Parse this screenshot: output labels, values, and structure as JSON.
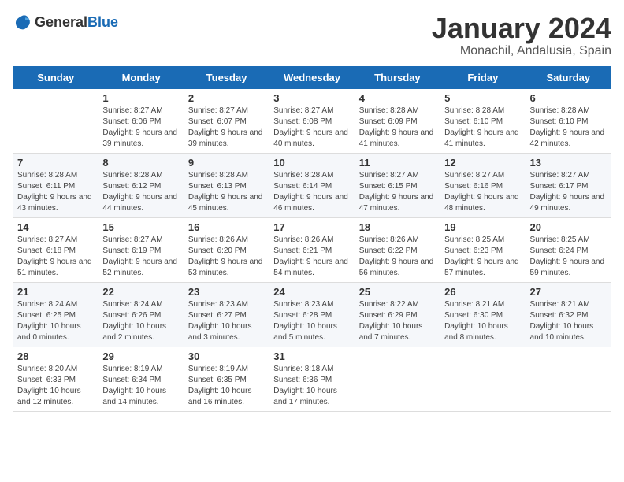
{
  "logo": {
    "text_general": "General",
    "text_blue": "Blue"
  },
  "header": {
    "month_year": "January 2024",
    "location": "Monachil, Andalusia, Spain"
  },
  "days_of_week": [
    "Sunday",
    "Monday",
    "Tuesday",
    "Wednesday",
    "Thursday",
    "Friday",
    "Saturday"
  ],
  "weeks": [
    [
      {
        "day": "",
        "sunrise": "",
        "sunset": "",
        "daylight": ""
      },
      {
        "day": "1",
        "sunrise": "Sunrise: 8:27 AM",
        "sunset": "Sunset: 6:06 PM",
        "daylight": "Daylight: 9 hours and 39 minutes."
      },
      {
        "day": "2",
        "sunrise": "Sunrise: 8:27 AM",
        "sunset": "Sunset: 6:07 PM",
        "daylight": "Daylight: 9 hours and 39 minutes."
      },
      {
        "day": "3",
        "sunrise": "Sunrise: 8:27 AM",
        "sunset": "Sunset: 6:08 PM",
        "daylight": "Daylight: 9 hours and 40 minutes."
      },
      {
        "day": "4",
        "sunrise": "Sunrise: 8:28 AM",
        "sunset": "Sunset: 6:09 PM",
        "daylight": "Daylight: 9 hours and 41 minutes."
      },
      {
        "day": "5",
        "sunrise": "Sunrise: 8:28 AM",
        "sunset": "Sunset: 6:10 PM",
        "daylight": "Daylight: 9 hours and 41 minutes."
      },
      {
        "day": "6",
        "sunrise": "Sunrise: 8:28 AM",
        "sunset": "Sunset: 6:10 PM",
        "daylight": "Daylight: 9 hours and 42 minutes."
      }
    ],
    [
      {
        "day": "7",
        "sunrise": "Sunrise: 8:28 AM",
        "sunset": "Sunset: 6:11 PM",
        "daylight": "Daylight: 9 hours and 43 minutes."
      },
      {
        "day": "8",
        "sunrise": "Sunrise: 8:28 AM",
        "sunset": "Sunset: 6:12 PM",
        "daylight": "Daylight: 9 hours and 44 minutes."
      },
      {
        "day": "9",
        "sunrise": "Sunrise: 8:28 AM",
        "sunset": "Sunset: 6:13 PM",
        "daylight": "Daylight: 9 hours and 45 minutes."
      },
      {
        "day": "10",
        "sunrise": "Sunrise: 8:28 AM",
        "sunset": "Sunset: 6:14 PM",
        "daylight": "Daylight: 9 hours and 46 minutes."
      },
      {
        "day": "11",
        "sunrise": "Sunrise: 8:27 AM",
        "sunset": "Sunset: 6:15 PM",
        "daylight": "Daylight: 9 hours and 47 minutes."
      },
      {
        "day": "12",
        "sunrise": "Sunrise: 8:27 AM",
        "sunset": "Sunset: 6:16 PM",
        "daylight": "Daylight: 9 hours and 48 minutes."
      },
      {
        "day": "13",
        "sunrise": "Sunrise: 8:27 AM",
        "sunset": "Sunset: 6:17 PM",
        "daylight": "Daylight: 9 hours and 49 minutes."
      }
    ],
    [
      {
        "day": "14",
        "sunrise": "Sunrise: 8:27 AM",
        "sunset": "Sunset: 6:18 PM",
        "daylight": "Daylight: 9 hours and 51 minutes."
      },
      {
        "day": "15",
        "sunrise": "Sunrise: 8:27 AM",
        "sunset": "Sunset: 6:19 PM",
        "daylight": "Daylight: 9 hours and 52 minutes."
      },
      {
        "day": "16",
        "sunrise": "Sunrise: 8:26 AM",
        "sunset": "Sunset: 6:20 PM",
        "daylight": "Daylight: 9 hours and 53 minutes."
      },
      {
        "day": "17",
        "sunrise": "Sunrise: 8:26 AM",
        "sunset": "Sunset: 6:21 PM",
        "daylight": "Daylight: 9 hours and 54 minutes."
      },
      {
        "day": "18",
        "sunrise": "Sunrise: 8:26 AM",
        "sunset": "Sunset: 6:22 PM",
        "daylight": "Daylight: 9 hours and 56 minutes."
      },
      {
        "day": "19",
        "sunrise": "Sunrise: 8:25 AM",
        "sunset": "Sunset: 6:23 PM",
        "daylight": "Daylight: 9 hours and 57 minutes."
      },
      {
        "day": "20",
        "sunrise": "Sunrise: 8:25 AM",
        "sunset": "Sunset: 6:24 PM",
        "daylight": "Daylight: 9 hours and 59 minutes."
      }
    ],
    [
      {
        "day": "21",
        "sunrise": "Sunrise: 8:24 AM",
        "sunset": "Sunset: 6:25 PM",
        "daylight": "Daylight: 10 hours and 0 minutes."
      },
      {
        "day": "22",
        "sunrise": "Sunrise: 8:24 AM",
        "sunset": "Sunset: 6:26 PM",
        "daylight": "Daylight: 10 hours and 2 minutes."
      },
      {
        "day": "23",
        "sunrise": "Sunrise: 8:23 AM",
        "sunset": "Sunset: 6:27 PM",
        "daylight": "Daylight: 10 hours and 3 minutes."
      },
      {
        "day": "24",
        "sunrise": "Sunrise: 8:23 AM",
        "sunset": "Sunset: 6:28 PM",
        "daylight": "Daylight: 10 hours and 5 minutes."
      },
      {
        "day": "25",
        "sunrise": "Sunrise: 8:22 AM",
        "sunset": "Sunset: 6:29 PM",
        "daylight": "Daylight: 10 hours and 7 minutes."
      },
      {
        "day": "26",
        "sunrise": "Sunrise: 8:21 AM",
        "sunset": "Sunset: 6:30 PM",
        "daylight": "Daylight: 10 hours and 8 minutes."
      },
      {
        "day": "27",
        "sunrise": "Sunrise: 8:21 AM",
        "sunset": "Sunset: 6:32 PM",
        "daylight": "Daylight: 10 hours and 10 minutes."
      }
    ],
    [
      {
        "day": "28",
        "sunrise": "Sunrise: 8:20 AM",
        "sunset": "Sunset: 6:33 PM",
        "daylight": "Daylight: 10 hours and 12 minutes."
      },
      {
        "day": "29",
        "sunrise": "Sunrise: 8:19 AM",
        "sunset": "Sunset: 6:34 PM",
        "daylight": "Daylight: 10 hours and 14 minutes."
      },
      {
        "day": "30",
        "sunrise": "Sunrise: 8:19 AM",
        "sunset": "Sunset: 6:35 PM",
        "daylight": "Daylight: 10 hours and 16 minutes."
      },
      {
        "day": "31",
        "sunrise": "Sunrise: 8:18 AM",
        "sunset": "Sunset: 6:36 PM",
        "daylight": "Daylight: 10 hours and 17 minutes."
      },
      {
        "day": "",
        "sunrise": "",
        "sunset": "",
        "daylight": ""
      },
      {
        "day": "",
        "sunrise": "",
        "sunset": "",
        "daylight": ""
      },
      {
        "day": "",
        "sunrise": "",
        "sunset": "",
        "daylight": ""
      }
    ]
  ]
}
